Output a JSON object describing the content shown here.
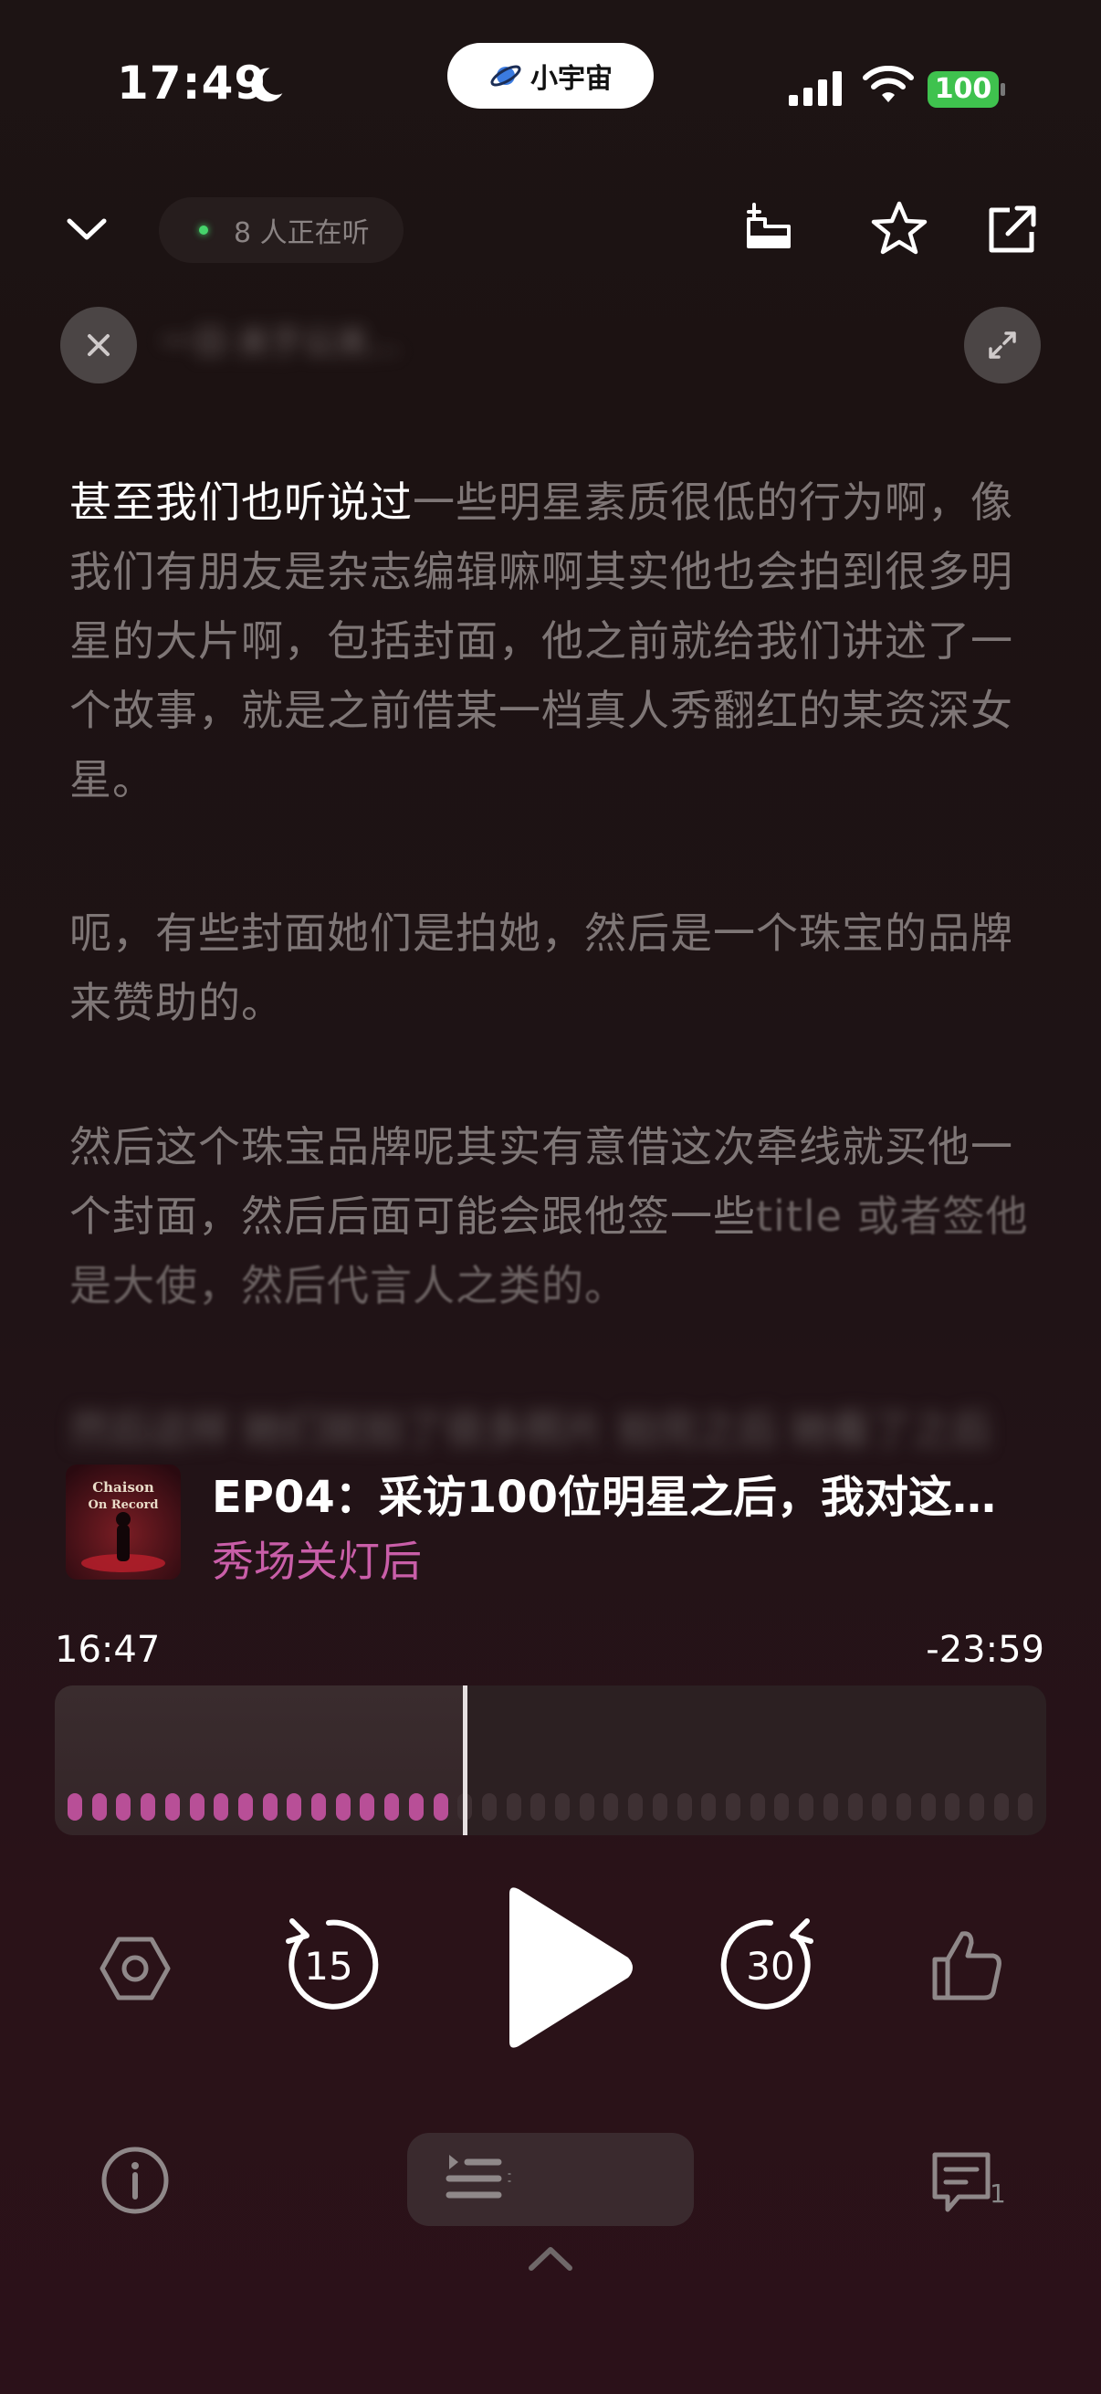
{
  "status_bar": {
    "time": "17:49",
    "island_label": "小宇宙",
    "battery": "100"
  },
  "header": {
    "listeners": "8 人正在听"
  },
  "transcript": {
    "chapter_title_blurred": "一日·关于公关...",
    "paragraph_1_highlight": "甚至我们也听说过",
    "paragraph_1_rest": "一些明星素质很低的行为啊，像我们有朋友是杂志编辑嘛啊其实他也会拍到很多明星的大片啊，包括封面，他之前就给我们讲述了一个故事，就是之前借某一档真人秀翻红的某资深女星。",
    "paragraph_2": "呃，有些封面她们是拍她，然后是一个珠宝的品牌来赞助的。",
    "paragraph_3_main": "然后这个珠宝品牌呢其实有意借这次牵线就买他一个封面，然后后面可能会跟他签一些",
    "paragraph_3_fade": "title 或者签他是大使，然后代言人之类的。",
    "blurred_line": "然后这样 她们就拍了很多照片 拍完之后 她看了之后"
  },
  "episode": {
    "title": "EP04：采访100位明星之后，我对这…",
    "show": "秀场关灯后",
    "cover_text_1": "Chaison",
    "cover_text_2": "On Record"
  },
  "progress": {
    "elapsed": "16:47",
    "remaining": "-23:59",
    "played_fraction": 0.413
  },
  "controls": {
    "rewind_seconds": "15",
    "forward_seconds": "30"
  },
  "bottom": {
    "comments_count": "1"
  },
  "colors": {
    "accent": "#c95ea8",
    "played_dot": "#b84f97",
    "unplayed_dot": "#3e3033"
  }
}
